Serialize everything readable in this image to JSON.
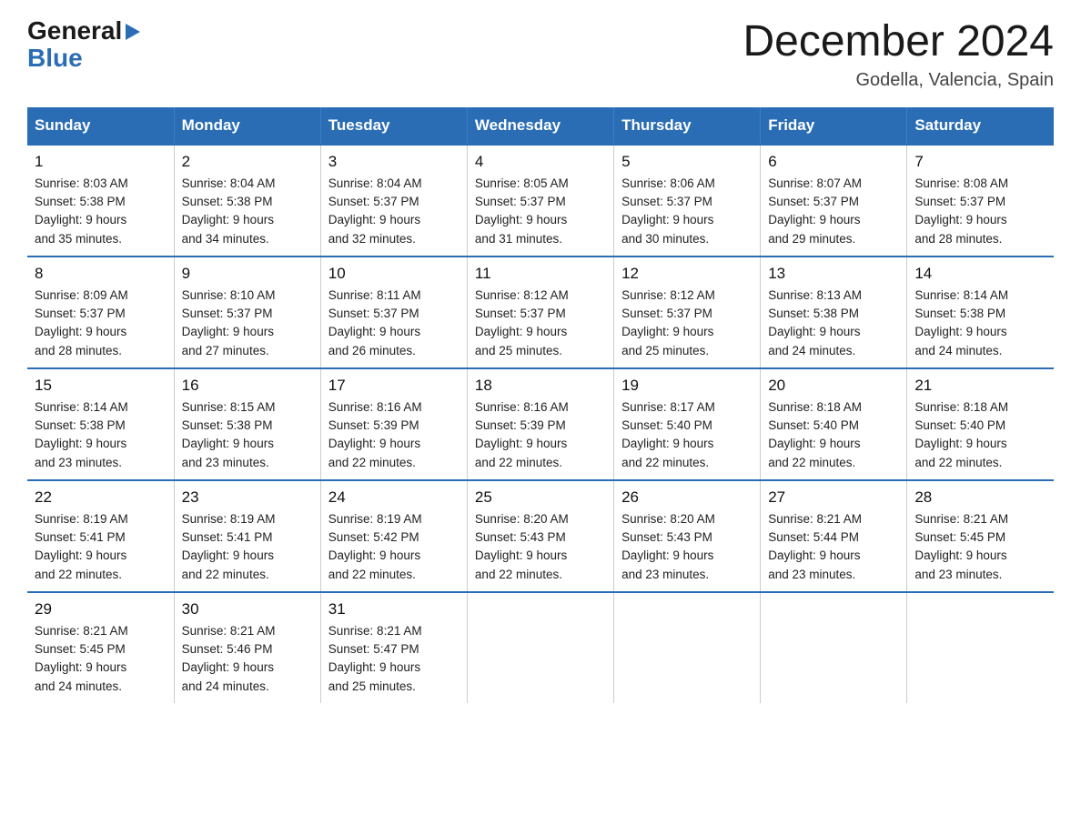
{
  "logo": {
    "general": "General",
    "arrow": "▶",
    "blue": "Blue"
  },
  "title": "December 2024",
  "subtitle": "Godella, Valencia, Spain",
  "days_of_week": [
    "Sunday",
    "Monday",
    "Tuesday",
    "Wednesday",
    "Thursday",
    "Friday",
    "Saturday"
  ],
  "weeks": [
    [
      {
        "num": "1",
        "sunrise": "8:03 AM",
        "sunset": "5:38 PM",
        "daylight": "9 hours and 35 minutes."
      },
      {
        "num": "2",
        "sunrise": "8:04 AM",
        "sunset": "5:38 PM",
        "daylight": "9 hours and 34 minutes."
      },
      {
        "num": "3",
        "sunrise": "8:04 AM",
        "sunset": "5:37 PM",
        "daylight": "9 hours and 32 minutes."
      },
      {
        "num": "4",
        "sunrise": "8:05 AM",
        "sunset": "5:37 PM",
        "daylight": "9 hours and 31 minutes."
      },
      {
        "num": "5",
        "sunrise": "8:06 AM",
        "sunset": "5:37 PM",
        "daylight": "9 hours and 30 minutes."
      },
      {
        "num": "6",
        "sunrise": "8:07 AM",
        "sunset": "5:37 PM",
        "daylight": "9 hours and 29 minutes."
      },
      {
        "num": "7",
        "sunrise": "8:08 AM",
        "sunset": "5:37 PM",
        "daylight": "9 hours and 28 minutes."
      }
    ],
    [
      {
        "num": "8",
        "sunrise": "8:09 AM",
        "sunset": "5:37 PM",
        "daylight": "9 hours and 28 minutes."
      },
      {
        "num": "9",
        "sunrise": "8:10 AM",
        "sunset": "5:37 PM",
        "daylight": "9 hours and 27 minutes."
      },
      {
        "num": "10",
        "sunrise": "8:11 AM",
        "sunset": "5:37 PM",
        "daylight": "9 hours and 26 minutes."
      },
      {
        "num": "11",
        "sunrise": "8:12 AM",
        "sunset": "5:37 PM",
        "daylight": "9 hours and 25 minutes."
      },
      {
        "num": "12",
        "sunrise": "8:12 AM",
        "sunset": "5:37 PM",
        "daylight": "9 hours and 25 minutes."
      },
      {
        "num": "13",
        "sunrise": "8:13 AM",
        "sunset": "5:38 PM",
        "daylight": "9 hours and 24 minutes."
      },
      {
        "num": "14",
        "sunrise": "8:14 AM",
        "sunset": "5:38 PM",
        "daylight": "9 hours and 24 minutes."
      }
    ],
    [
      {
        "num": "15",
        "sunrise": "8:14 AM",
        "sunset": "5:38 PM",
        "daylight": "9 hours and 23 minutes."
      },
      {
        "num": "16",
        "sunrise": "8:15 AM",
        "sunset": "5:38 PM",
        "daylight": "9 hours and 23 minutes."
      },
      {
        "num": "17",
        "sunrise": "8:16 AM",
        "sunset": "5:39 PM",
        "daylight": "9 hours and 22 minutes."
      },
      {
        "num": "18",
        "sunrise": "8:16 AM",
        "sunset": "5:39 PM",
        "daylight": "9 hours and 22 minutes."
      },
      {
        "num": "19",
        "sunrise": "8:17 AM",
        "sunset": "5:40 PM",
        "daylight": "9 hours and 22 minutes."
      },
      {
        "num": "20",
        "sunrise": "8:18 AM",
        "sunset": "5:40 PM",
        "daylight": "9 hours and 22 minutes."
      },
      {
        "num": "21",
        "sunrise": "8:18 AM",
        "sunset": "5:40 PM",
        "daylight": "9 hours and 22 minutes."
      }
    ],
    [
      {
        "num": "22",
        "sunrise": "8:19 AM",
        "sunset": "5:41 PM",
        "daylight": "9 hours and 22 minutes."
      },
      {
        "num": "23",
        "sunrise": "8:19 AM",
        "sunset": "5:41 PM",
        "daylight": "9 hours and 22 minutes."
      },
      {
        "num": "24",
        "sunrise": "8:19 AM",
        "sunset": "5:42 PM",
        "daylight": "9 hours and 22 minutes."
      },
      {
        "num": "25",
        "sunrise": "8:20 AM",
        "sunset": "5:43 PM",
        "daylight": "9 hours and 22 minutes."
      },
      {
        "num": "26",
        "sunrise": "8:20 AM",
        "sunset": "5:43 PM",
        "daylight": "9 hours and 23 minutes."
      },
      {
        "num": "27",
        "sunrise": "8:21 AM",
        "sunset": "5:44 PM",
        "daylight": "9 hours and 23 minutes."
      },
      {
        "num": "28",
        "sunrise": "8:21 AM",
        "sunset": "5:45 PM",
        "daylight": "9 hours and 23 minutes."
      }
    ],
    [
      {
        "num": "29",
        "sunrise": "8:21 AM",
        "sunset": "5:45 PM",
        "daylight": "9 hours and 24 minutes."
      },
      {
        "num": "30",
        "sunrise": "8:21 AM",
        "sunset": "5:46 PM",
        "daylight": "9 hours and 24 minutes."
      },
      {
        "num": "31",
        "sunrise": "8:21 AM",
        "sunset": "5:47 PM",
        "daylight": "9 hours and 25 minutes."
      },
      null,
      null,
      null,
      null
    ]
  ],
  "labels": {
    "sunrise": "Sunrise:",
    "sunset": "Sunset:",
    "daylight": "Daylight:"
  }
}
